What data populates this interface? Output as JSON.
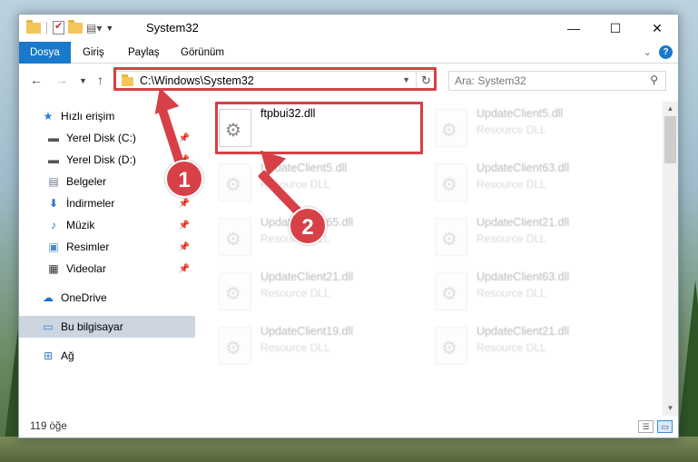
{
  "window": {
    "title": "System32",
    "controls": {
      "minimize": "—",
      "maximize": "☐",
      "close": "✕"
    }
  },
  "ribbon": {
    "tabs": [
      {
        "label": "Dosya",
        "active": true
      },
      {
        "label": "Giriş",
        "active": false
      },
      {
        "label": "Paylaş",
        "active": false
      },
      {
        "label": "Görünüm",
        "active": false
      }
    ],
    "help": "?"
  },
  "navigation": {
    "address": "C:\\Windows\\System32",
    "search_placeholder": "Ara: System32"
  },
  "sidebar": {
    "items": [
      {
        "label": "Hızlı erişim",
        "icon": "star-icon",
        "pinned": false
      },
      {
        "label": "Yerel Disk (C:)",
        "icon": "drive-icon",
        "pinned": true
      },
      {
        "label": "Yerel Disk (D:)",
        "icon": "drive-icon",
        "pinned": true
      },
      {
        "label": "Belgeler",
        "icon": "documents-icon",
        "pinned": true
      },
      {
        "label": "İndirmeler",
        "icon": "download-icon",
        "pinned": true
      },
      {
        "label": "Müzik",
        "icon": "music-icon",
        "pinned": true
      },
      {
        "label": "Resimler",
        "icon": "pictures-icon",
        "pinned": true
      },
      {
        "label": "Videolar",
        "icon": "videos-icon",
        "pinned": true
      },
      {
        "label": "OneDrive",
        "icon": "cloud-icon",
        "pinned": false
      },
      {
        "label": "Bu bilgisayar",
        "icon": "computer-icon",
        "pinned": false,
        "selected": true
      },
      {
        "label": "Ağ",
        "icon": "network-icon",
        "pinned": false
      }
    ]
  },
  "files": [
    {
      "name": "ftpbui32.dll",
      "type": ""
    },
    {
      "name": "UpdateClient5.dll",
      "type": "Resource DLL"
    },
    {
      "name": "UpdateClient5.dll",
      "type": "Resource DLL"
    },
    {
      "name": "UpdateClient63.dll",
      "type": "Resource DLL"
    },
    {
      "name": "UpdateClient65.dll",
      "type": "Resource DLL"
    },
    {
      "name": "UpdateClient21.dll",
      "type": "Resource DLL"
    },
    {
      "name": "UpdateClient21.dll",
      "type": "Resource DLL"
    },
    {
      "name": "UpdateClient63.dll",
      "type": "Resource DLL"
    },
    {
      "name": "UpdateClient19.dll",
      "type": "Resource DLL"
    },
    {
      "name": "UpdateClient21.dll",
      "type": "Resource DLL"
    }
  ],
  "status": {
    "item_count": "119 öğe"
  },
  "annotations": {
    "step1": "1",
    "step2": "2",
    "color": "#d64046"
  }
}
